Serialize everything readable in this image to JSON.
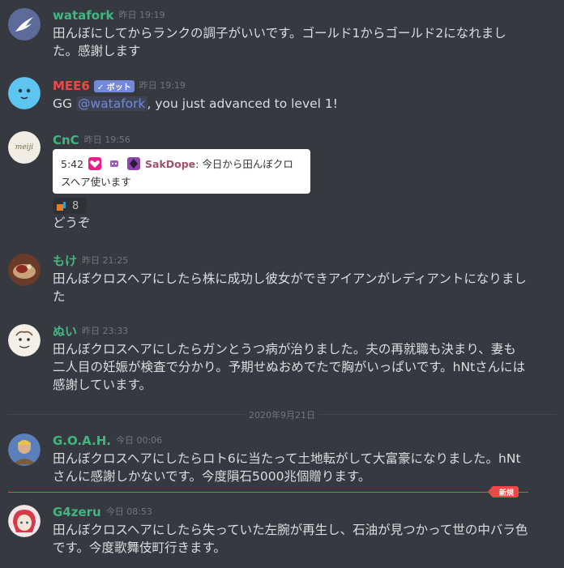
{
  "messages": [
    {
      "user": "watafork",
      "user_color": "#43b581",
      "time": "昨日 19:19",
      "text": "田んぼにしてからランクの調子がいいです。ゴールド1からゴールド2になれました。感謝します"
    },
    {
      "user": "MEE6",
      "user_color": "#f04747",
      "bot_tag": "✓ ボット",
      "time": "昨日 19:19",
      "text_prefix": "GG ",
      "mention": "@watafork",
      "text_suffix": ", you just advanced to level 1!"
    },
    {
      "user": "CnC",
      "user_color": "#43b581",
      "time": "昨日 19:56",
      "avatar_text": "meiji",
      "embed": {
        "time": "5:42",
        "author": "SakDope",
        "text": ": 今日から田んぼクロスヘア使います"
      },
      "reaction_count": "8",
      "text": "どうぞ"
    },
    {
      "user": "もけ",
      "user_color": "#43b581",
      "time": "昨日 21:25",
      "text": "田んぼクロスヘアにしたら株に成功し彼女ができアイアンがレディアントになりました"
    },
    {
      "user": "ぬい",
      "user_color": "#43b581",
      "time": "昨日 23:33",
      "text": "田んぼクロスヘアにしたらガンとうつ病が治りました。夫の再就職も決まり、妻も二人目の妊娠が検査で分かり。予期せぬおめでたで胸がいっぱいです。hNtさんには感謝しています。"
    },
    {
      "user": "G.O.A.H.",
      "user_color": "#43b581",
      "time": "今日 00:06",
      "text": "田んぼクロスヘアにしたらロト6に当たって土地転がして大富豪になりました。hNtさんに感謝しかないです。今度隕石5000兆個贈ります。"
    },
    {
      "user": "G4zeru",
      "user_color": "#43b581",
      "time": "今日 08:53",
      "text": "田んぼクロスヘアにしたら失っていた左腕が再生し、石油が見つかって世の中バラ色です。今度歌舞伎町行きます。"
    }
  ],
  "date_divider": "2020年9月21日",
  "new_badge": "新規",
  "colors": {
    "background": "#36393f",
    "mention": "#7289da",
    "new_marker": "#f04747"
  }
}
